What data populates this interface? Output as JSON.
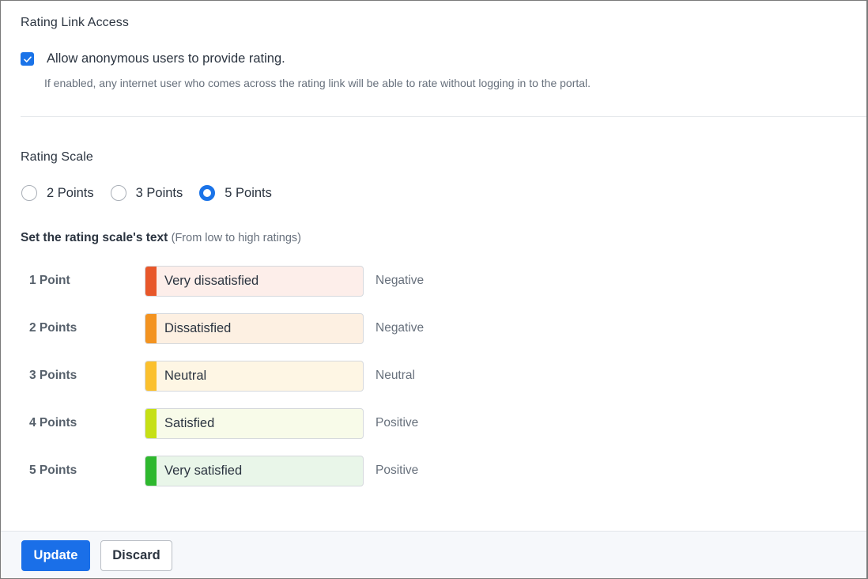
{
  "link_access": {
    "title": "Rating Link Access",
    "checkbox_label": "Allow anonymous users to provide rating.",
    "checkbox_checked": true,
    "hint": "If enabled, any internet user who comes across the rating link will be able to rate without logging in to the portal."
  },
  "rating_scale": {
    "title": "Rating Scale",
    "options": [
      {
        "label": "2 Points",
        "selected": false
      },
      {
        "label": "3 Points",
        "selected": false
      },
      {
        "label": "5 Points",
        "selected": true
      }
    ]
  },
  "scale_text": {
    "title": "Set the rating scale's text",
    "subtitle": "(From low to high ratings)",
    "rows": [
      {
        "label": "1 Point",
        "value": "Very dissatisfied",
        "sentiment": "Negative",
        "color": "#e8572a",
        "bg": "#fdeeea"
      },
      {
        "label": "2 Points",
        "value": "Dissatisfied",
        "sentiment": "Negative",
        "color": "#f39320",
        "bg": "#fdf0e2"
      },
      {
        "label": "3 Points",
        "value": "Neutral",
        "sentiment": "Neutral",
        "color": "#fbc02d",
        "bg": "#fef6e4"
      },
      {
        "label": "4 Points",
        "value": "Satisfied",
        "sentiment": "Positive",
        "color": "#c6e015",
        "bg": "#f8fbe9"
      },
      {
        "label": "5 Points",
        "value": "Very satisfied",
        "sentiment": "Positive",
        "color": "#2eb82e",
        "bg": "#e9f6e9"
      }
    ]
  },
  "footer": {
    "update_label": "Update",
    "discard_label": "Discard"
  },
  "colors": {
    "accent": "#1a73e8"
  }
}
